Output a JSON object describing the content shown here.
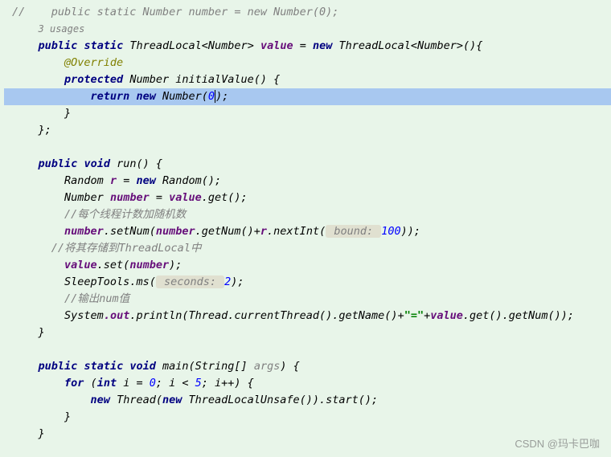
{
  "watermark": "CSDN @玛卡巴咖",
  "lines": {
    "l1_comment": "//    public static Number number = new Number(0);",
    "l2_usages": "3 usages",
    "l3": {
      "public": "public",
      "static": "static",
      "ThreadLocal": "ThreadLocal",
      "Number1": "Number",
      "value": "value",
      "eq": " = ",
      "new": "new",
      "ThreadLocal2": "ThreadLocal",
      "Number2": "Number",
      "tail": "(){"
    },
    "l4_annotation": "@Override",
    "l5": {
      "protected": "protected",
      "Number": "Number",
      "initialValue": "initialValue",
      "tail": "() {"
    },
    "l6": {
      "return": "return",
      "new": "new",
      "Number": "Number",
      "open": "(",
      "zero": "0",
      "close": ");"
    },
    "l7": "}",
    "l8": "};",
    "l10": {
      "public": "public",
      "void": "void",
      "run": "run",
      "tail": "() {"
    },
    "l11": {
      "Random1": "Random",
      "r": "r",
      "eq": " = ",
      "new": "new",
      "Random2": "Random",
      "tail": "();"
    },
    "l12": {
      "Number": "Number",
      "number": "number",
      "eq": " = ",
      "value": "value",
      "get": ".get();"
    },
    "l13_comment": "//每个线程计数加随机数",
    "l14": {
      "number1": "number",
      "setNum": ".setNum(",
      "number2": "number",
      "getNum": ".getNum()+",
      "r": "r",
      "nextInt": ".nextInt(",
      "hint": " bound: ",
      "hundred": "100",
      "tail": "));"
    },
    "l15_comment": "//将其存储到ThreadLocal中",
    "l16": {
      "value": "value",
      "set": ".set(",
      "number": "number",
      "tail": ");"
    },
    "l17": {
      "SleepTools": "SleepTools",
      "ms": ".ms(",
      "hint": " seconds: ",
      "two": "2",
      "tail": ");"
    },
    "l18_comment": "//输出num值",
    "l19": {
      "System": "System",
      "out": ".out",
      "println": ".println(Thread.currentThread().getName()+",
      "eq": "\"=\"",
      "plus": "+",
      "value": "value",
      "tail": ".get().getNum());"
    },
    "l20": "}",
    "l22": {
      "public": "public",
      "static": "static",
      "void": "void",
      "main": "main",
      "open": "(String[] ",
      "args": "args",
      "close": ") {"
    },
    "l23": {
      "for": "for",
      "open": " (",
      "int": "int",
      "i1": " i = ",
      "zero": "0",
      "semi": "; i < ",
      "five": "5",
      "tail": "; i++) {"
    },
    "l24": {
      "new1": "new",
      "Thread": " Thread(",
      "new2": "new",
      "Unsafe": " ThreadLocalUnsafe()).start();"
    },
    "l25": "}",
    "l26": "}"
  }
}
